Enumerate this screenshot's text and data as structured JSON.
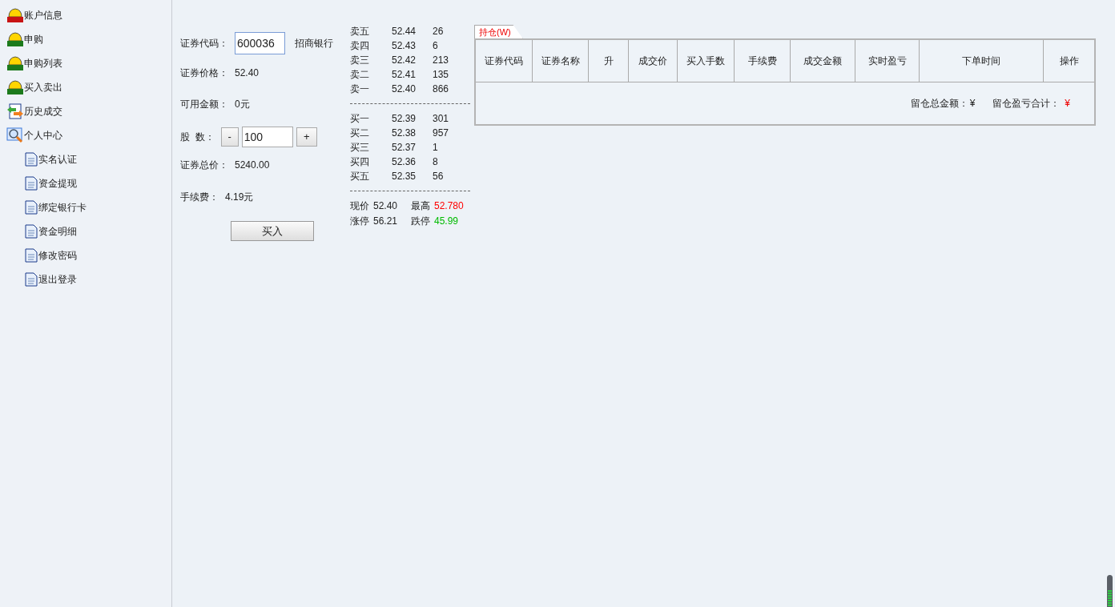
{
  "sidebar": {
    "items": [
      {
        "label": "账户信息",
        "kind": "buy"
      },
      {
        "label": "申购",
        "kind": "sell"
      },
      {
        "label": "申购列表",
        "kind": "sell"
      },
      {
        "label": "买入卖出",
        "kind": "sell"
      },
      {
        "label": "历史成交",
        "kind": "history"
      },
      {
        "label": "个人中心",
        "kind": "search",
        "children": [
          {
            "label": "实名认证",
            "kind": "doc"
          },
          {
            "label": "资金提现",
            "kind": "doc"
          },
          {
            "label": "绑定银行卡",
            "kind": "doc"
          },
          {
            "label": "资金明细",
            "kind": "doc"
          },
          {
            "label": "修改密码",
            "kind": "doc"
          },
          {
            "label": "退出登录",
            "kind": "doc"
          }
        ]
      }
    ]
  },
  "order_form": {
    "code_label": "证券代码：",
    "code_value": "600036",
    "stock_name": "招商银行",
    "rows_top": [
      {
        "label": "证券价格：",
        "value": "52.40"
      },
      {
        "label": "可用金额：",
        "value": "0元"
      }
    ],
    "shares_label": "股  数：",
    "minus": "-",
    "shares_value": "100",
    "plus": "+",
    "rows_bottom": [
      {
        "label": "证券总价：",
        "value": "5240.00"
      },
      {
        "label": "手续费：",
        "value": "4.19元"
      }
    ],
    "buy_button": "买入"
  },
  "order_book": {
    "asks": [
      {
        "name": "卖五",
        "price": "52.44",
        "volume": "26"
      },
      {
        "name": "卖四",
        "price": "52.43",
        "volume": "6"
      },
      {
        "name": "卖三",
        "price": "52.42",
        "volume": "213"
      },
      {
        "name": "卖二",
        "price": "52.41",
        "volume": "135"
      },
      {
        "name": "卖一",
        "price": "52.40",
        "volume": "866"
      }
    ],
    "bids": [
      {
        "name": "买一",
        "price": "52.39",
        "volume": "301"
      },
      {
        "name": "买二",
        "price": "52.38",
        "volume": "957"
      },
      {
        "name": "买三",
        "price": "52.37",
        "volume": "1"
      },
      {
        "name": "买四",
        "price": "52.36",
        "volume": "8"
      },
      {
        "name": "买五",
        "price": "52.35",
        "volume": "56"
      }
    ],
    "stats": [
      {
        "label": "现价",
        "value": "52.40",
        "color": "#222222"
      },
      {
        "label": "最高",
        "value": "52.780",
        "color": "#ff0000"
      },
      {
        "label": "涨停",
        "value": "56.21",
        "color": "#222222"
      },
      {
        "label": "跌停",
        "value": "45.99",
        "color": "#00bb00"
      }
    ]
  },
  "positions": {
    "tab": "持仓(W)",
    "columns": [
      "证券代码",
      "证券名称",
      "升",
      "成交价",
      "买入手数",
      "手续费",
      "成交金额",
      "实时盈亏",
      "下单时间",
      "操作"
    ],
    "total_amount_label": "留仓总金额：",
    "total_amount_value": "¥",
    "total_pl_label": "留仓盈亏合计：",
    "total_pl_value": "¥"
  }
}
